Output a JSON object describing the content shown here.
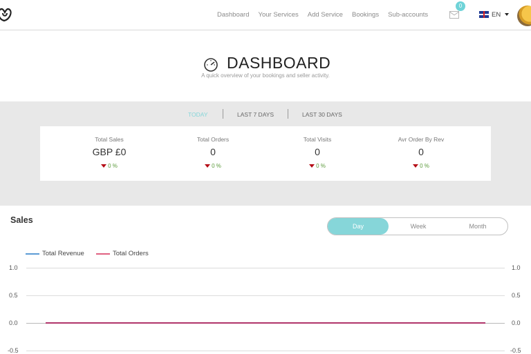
{
  "nav": {
    "links": [
      "Dashboard",
      "Your Services",
      "Add Service",
      "Bookings",
      "Sub-accounts"
    ],
    "mail_badge": "0",
    "language": "EN"
  },
  "header": {
    "title": "DASHBOARD",
    "subtitle": "A quick overview of your bookings and seller activity."
  },
  "periods": [
    {
      "label": "TODAY",
      "active": true
    },
    {
      "label": "LAST 7 DAYS",
      "active": false
    },
    {
      "label": "LAST 30 DAYS",
      "active": false
    }
  ],
  "stats": [
    {
      "label": "Total Sales",
      "value": "GBP £0",
      "change": "0 %"
    },
    {
      "label": "Total Orders",
      "value": "0",
      "change": "0 %"
    },
    {
      "label": "Total Visits",
      "value": "0",
      "change": "0 %"
    },
    {
      "label": "Avr Order By Rev",
      "value": "0",
      "change": "0 %"
    }
  ],
  "sales": {
    "title": "Sales",
    "toggle": [
      {
        "label": "Day",
        "active": true
      },
      {
        "label": "Week",
        "active": false
      },
      {
        "label": "Month",
        "active": false
      }
    ]
  },
  "colors": {
    "accent": "#86d6d9",
    "revenue": "#5b9bd5",
    "orders": "#e06080",
    "decline": "#b50f18"
  },
  "chart_data": {
    "type": "line",
    "series": [
      {
        "name": "Total Revenue",
        "values": [
          0
        ]
      },
      {
        "name": "Total Orders",
        "values": [
          0
        ]
      }
    ],
    "y_ticks_left": [
      "1.0",
      "0.5",
      "0.0",
      "-0.5"
    ],
    "y_ticks_right": [
      "1.0",
      "0.5",
      "0.0",
      "-0.5"
    ],
    "ylim": [
      -0.5,
      1.0
    ],
    "legend": "top-left",
    "grid": true
  }
}
